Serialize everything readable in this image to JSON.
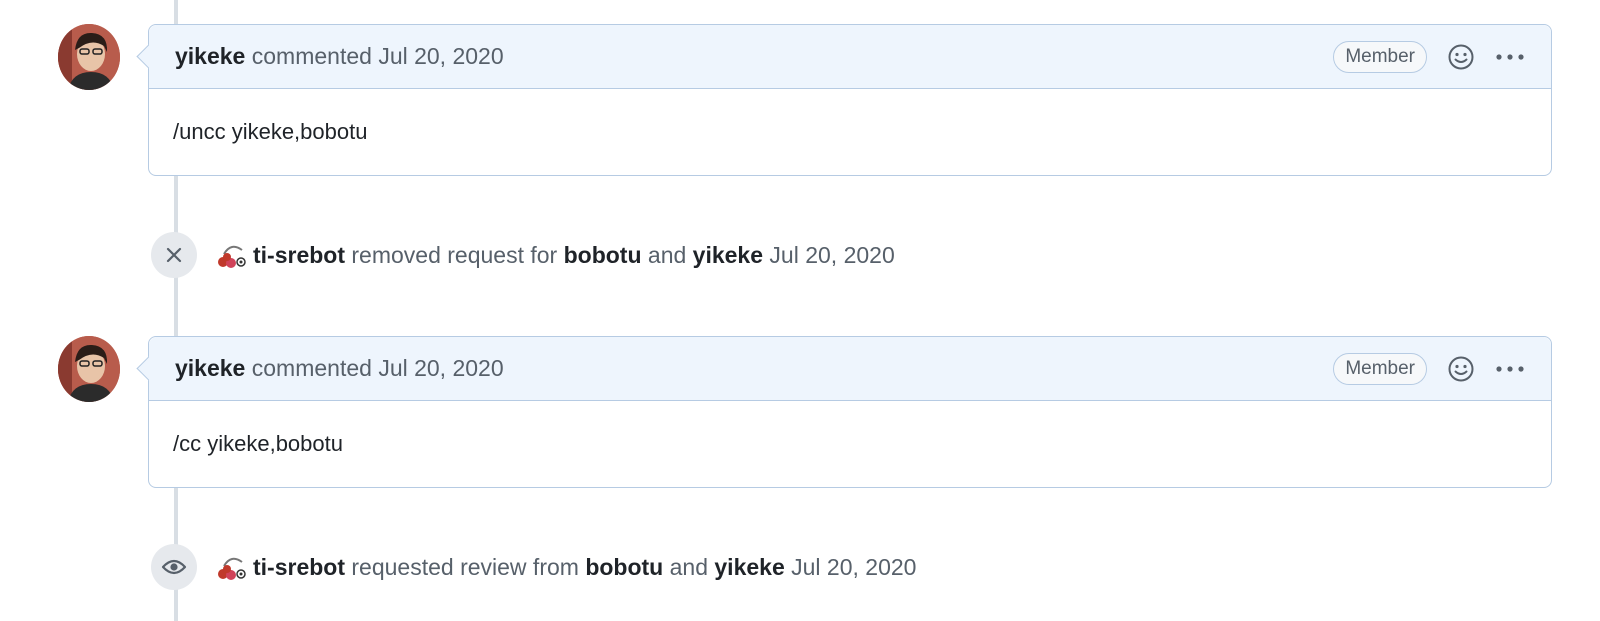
{
  "comments": [
    {
      "author": "yikeke",
      "action": "commented",
      "date": "Jul 20, 2020",
      "role": "Member",
      "body": "/uncc yikeke,bobotu"
    },
    {
      "author": "yikeke",
      "action": "commented",
      "date": "Jul 20, 2020",
      "role": "Member",
      "body": "/cc yikeke,bobotu"
    }
  ],
  "events": [
    {
      "icon": "x-icon",
      "actor": "ti-srebot",
      "action": "removed request for",
      "user1": "bobotu",
      "conjunction": "and",
      "user2": "yikeke",
      "date": "Jul 20, 2020"
    },
    {
      "icon": "eye-icon",
      "actor": "ti-srebot",
      "action": "requested review from",
      "user1": "bobotu",
      "conjunction": "and",
      "user2": "yikeke",
      "date": "Jul 20, 2020"
    }
  ],
  "colors": {
    "header_bg": "#eef5fd",
    "border": "#b6cbe3",
    "timeline": "#d8dee4",
    "muted_text": "#57606a"
  }
}
